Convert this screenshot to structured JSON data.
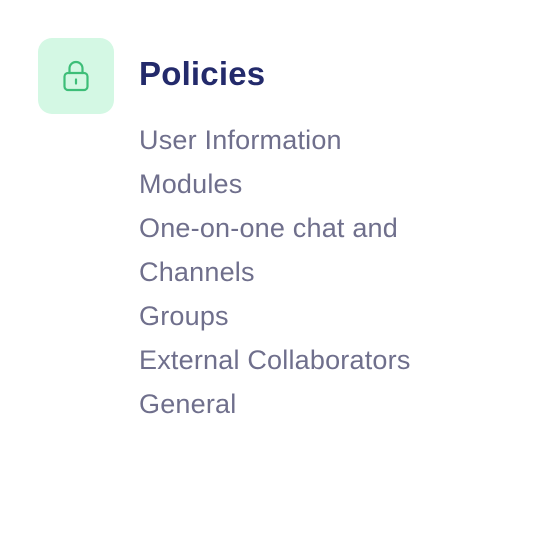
{
  "section": {
    "title": "Policies",
    "icon": "lock-icon",
    "icon_bg_color": "#d4f8e4",
    "icon_color": "#3dbe78",
    "title_color": "#232a6b",
    "link_color": "#6f6f8c"
  },
  "links": [
    {
      "label": "User Information"
    },
    {
      "label": "Modules"
    },
    {
      "label": "One-on-one chat and Channels"
    },
    {
      "label": "Groups"
    },
    {
      "label": "External Collaborators"
    },
    {
      "label": "General"
    }
  ]
}
